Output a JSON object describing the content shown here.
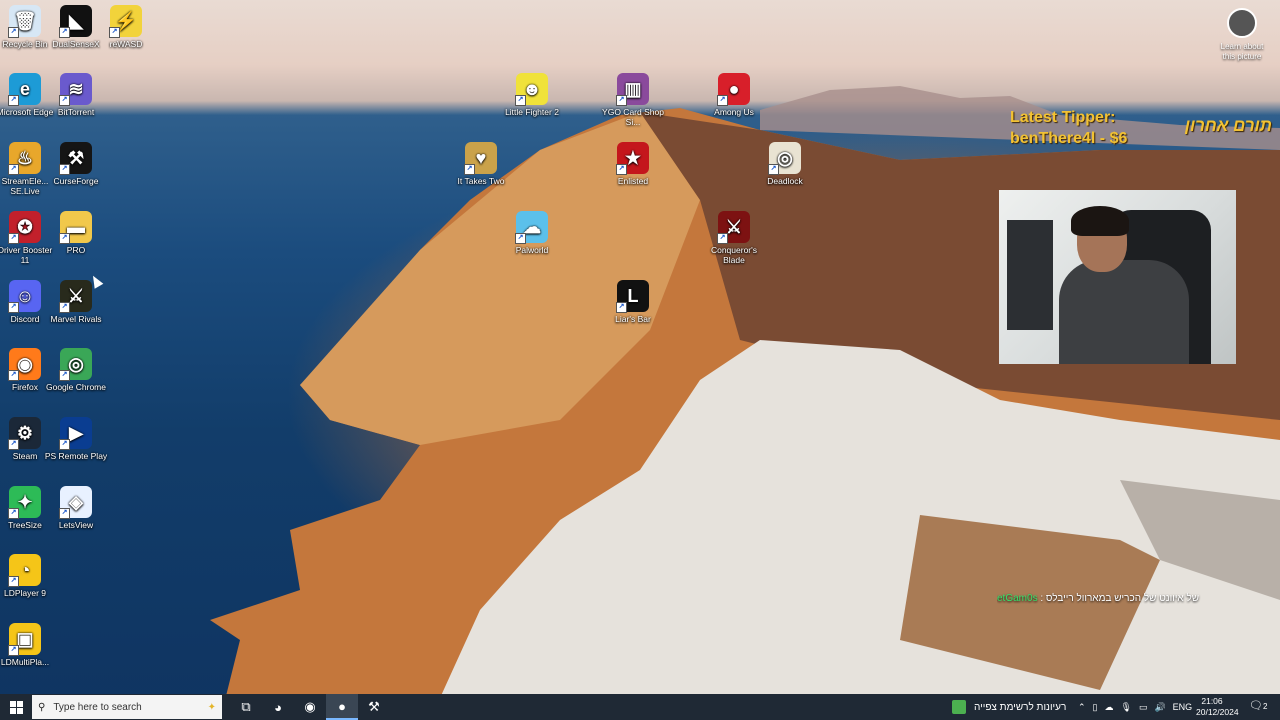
{
  "desktop": {
    "left_icons": [
      {
        "name": "recycle-bin",
        "label": "Recycle Bin",
        "glyph": "🗑",
        "color": "#d7e7f5"
      },
      {
        "name": "dualsensex",
        "label": "DualSenseX",
        "glyph": "◣",
        "color": "#111111"
      },
      {
        "name": "rewasd",
        "label": "reWASD",
        "glyph": "⚡",
        "color": "#f2d33b"
      },
      {
        "name": "microsoft-edge",
        "label": "Microsoft Edge",
        "glyph": "e",
        "color": "#1d9bd6"
      },
      {
        "name": "bittorrent",
        "label": "BitTorrent",
        "glyph": "≋",
        "color": "#6a5acd"
      },
      {
        "name": "streamelements",
        "label": "StreamEle... SE.Live",
        "glyph": "♨",
        "color": "#e8a72b"
      },
      {
        "name": "curseforge",
        "label": "CurseForge",
        "glyph": "⚒",
        "color": "#151515"
      },
      {
        "name": "driver-booster",
        "label": "Driver Booster 11",
        "glyph": "✪",
        "color": "#c2202b"
      },
      {
        "name": "pro-folder",
        "label": "PRO",
        "glyph": "▬",
        "color": "#f1c84b"
      },
      {
        "name": "discord",
        "label": "Discord",
        "glyph": "☺",
        "color": "#5865f2"
      },
      {
        "name": "marvel-rivals",
        "label": "Marvel Rivals",
        "glyph": "⚔",
        "color": "#282a1c"
      },
      {
        "name": "firefox",
        "label": "Firefox",
        "glyph": "◉",
        "color": "#ff7a1a"
      },
      {
        "name": "google-chrome",
        "label": "Google Chrome",
        "glyph": "◎",
        "color": "#3aa757"
      },
      {
        "name": "steam",
        "label": "Steam",
        "glyph": "⚙",
        "color": "#1b2838"
      },
      {
        "name": "ps-remote-play",
        "label": "PS Remote Play",
        "glyph": "▶",
        "color": "#0a3d91"
      },
      {
        "name": "treesize",
        "label": "TreeSize",
        "glyph": "✦",
        "color": "#2dbb57"
      },
      {
        "name": "letsview",
        "label": "LetsView",
        "glyph": "◈",
        "color": "#e8f1ff"
      },
      {
        "name": "ldplayer",
        "label": "LDPlayer 9",
        "glyph": "◔",
        "color": "#f5c518"
      },
      {
        "name": "ldmultiplayer",
        "label": "LDMultiPla...",
        "glyph": "▣",
        "color": "#f5c518"
      }
    ],
    "right_icons": [
      {
        "name": "little-fighter",
        "label": "Little Fighter 2",
        "glyph": "☻",
        "color": "#f0e23a"
      },
      {
        "name": "yugioh-card-shop",
        "label": "YGO Card Shop Si...",
        "glyph": "▥",
        "color": "#8a4a9c"
      },
      {
        "name": "among-us",
        "label": "Among Us",
        "glyph": "●",
        "color": "#d81f2a"
      },
      {
        "name": "it-takes-two",
        "label": "It Takes Two",
        "glyph": "♥",
        "color": "#caa24a"
      },
      {
        "name": "enlisted",
        "label": "Enlisted",
        "glyph": "★",
        "color": "#c4161c"
      },
      {
        "name": "deadlock",
        "label": "Deadlock",
        "glyph": "◎",
        "color": "#e9e3d2"
      },
      {
        "name": "palworld",
        "label": "Palworld",
        "glyph": "☁",
        "color": "#5bc0eb"
      },
      {
        "name": "conquerors-blade",
        "label": "Conqueror's Blade",
        "glyph": "⚔",
        "color": "#7d1212"
      },
      {
        "name": "liars-bar",
        "label": "Liar's Bar",
        "glyph": "L",
        "color": "#111111"
      }
    ],
    "learn": "Learn about this picture"
  },
  "overlay": {
    "tipper_label": "Latest Tipper:",
    "tipper_name": "benThere4l - $6",
    "tipper_rtl": "תורם אחרון",
    "marquee_user": "etGam0s",
    "marquee_text": " : של איוונט של הכריש במארוול רייבלס"
  },
  "taskbar": {
    "start_icon": "windows-icon",
    "search_placeholder": "Type here to search",
    "apps": [
      {
        "name": "task-view",
        "glyph": "⧉"
      },
      {
        "name": "messenger",
        "glyph": "◕"
      },
      {
        "name": "firefox",
        "glyph": "◉"
      },
      {
        "name": "obs",
        "glyph": "●"
      },
      {
        "name": "curseforge",
        "glyph": "⚒"
      }
    ],
    "news": "רעיונות לרשימת צפייה",
    "language": "ENG",
    "time": "21:06",
    "date": "20/12/2024",
    "notifications": "2"
  },
  "colors": {
    "taskbar_bg": "#1f2935",
    "tipper_gold": "#f2c233",
    "marquee_green": "#38e06a"
  }
}
